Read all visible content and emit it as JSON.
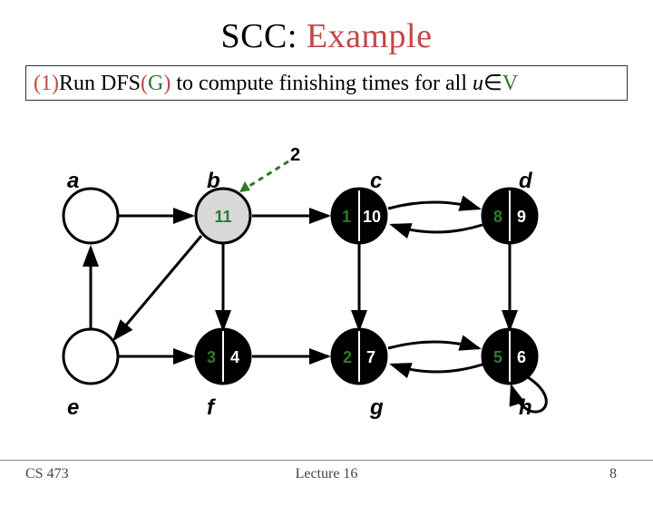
{
  "title_left": "SCC: ",
  "title_right": "Example",
  "step_num": "(1)",
  "step_run": "Run ",
  "step_dfs": "DFS",
  "step_paren_open": "(",
  "step_g": "G",
  "step_paren_close": ")",
  "step_mid": " to compute finishing times for all ",
  "step_u": "u",
  "step_in": "∈",
  "step_v": "V",
  "two": "2",
  "labels": {
    "a": "a",
    "b": "b",
    "c": "c",
    "d": "d",
    "e": "e",
    "f": "f",
    "g": "g",
    "h": "h"
  },
  "nodes": {
    "b": {
      "left": "11",
      "right": ""
    },
    "c": {
      "left": "1",
      "right": "10"
    },
    "d": {
      "left": "8",
      "right": "9"
    },
    "f": {
      "left": "3",
      "right": "4"
    },
    "g": {
      "left": "2",
      "right": "7"
    },
    "h": {
      "left": "5",
      "right": "6"
    }
  },
  "footer": {
    "left": "CS 473",
    "center": "Lecture 16",
    "right": "8"
  }
}
